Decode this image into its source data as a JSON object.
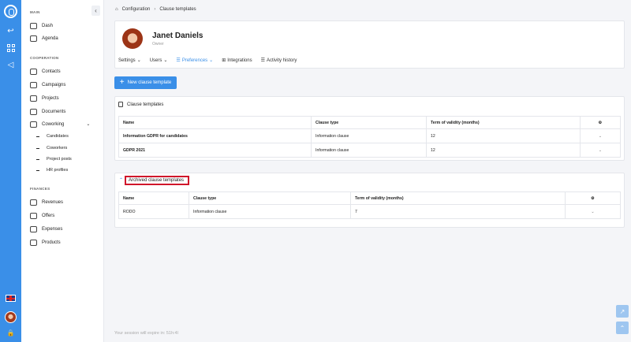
{
  "sidebar": {
    "sections": {
      "main": "MAIN",
      "cooperation": "COOPERATION",
      "finances": "FINANCES"
    },
    "main_items": [
      {
        "label": "Dash",
        "icon": "dashboard-icon"
      },
      {
        "label": "Agenda",
        "icon": "calendar-icon"
      }
    ],
    "cooperation_items": [
      {
        "label": "Contacts",
        "icon": "contacts-icon"
      },
      {
        "label": "Campaigns",
        "icon": "campaigns-icon"
      },
      {
        "label": "Projects",
        "icon": "projects-icon"
      },
      {
        "label": "Documents",
        "icon": "documents-icon"
      },
      {
        "label": "Coworking",
        "icon": "coworking-icon"
      }
    ],
    "coworking_sub": [
      "Candidates",
      "Coworkers",
      "Project posts",
      "HR profiles"
    ],
    "finance_items": [
      {
        "label": "Revenues",
        "icon": "revenues-icon"
      },
      {
        "label": "Offers",
        "icon": "offers-icon"
      },
      {
        "label": "Expenses",
        "icon": "expenses-icon"
      },
      {
        "label": "Products",
        "icon": "products-icon"
      }
    ]
  },
  "breadcrumb": {
    "root": "Configuration",
    "current": "Clause templates"
  },
  "profile": {
    "name": "Janet Daniels",
    "role": "Owner"
  },
  "tabs": [
    {
      "label": "Settings",
      "has_caret": true
    },
    {
      "label": "Users",
      "has_caret": true
    },
    {
      "label": "Preferences",
      "has_caret": true,
      "active": true
    },
    {
      "label": "Integrations",
      "has_caret": false
    },
    {
      "label": "Activity history",
      "has_caret": false
    }
  ],
  "new_button": "New clause template",
  "templates": {
    "title": "Clause templates",
    "headers": [
      "Name",
      "Clause type",
      "Term of validity (months)",
      "⚙"
    ],
    "rows": [
      [
        "Information GDPR for candidates",
        "Information clause",
        "12"
      ],
      [
        "GDPR 2021",
        "Information clause",
        "12"
      ]
    ]
  },
  "archived": {
    "title": "Archived clause templates",
    "headers": [
      "Name",
      "Clause type",
      "Term of validity (months)",
      "⚙"
    ],
    "rows": [
      [
        "RODO",
        "Information clause",
        "7"
      ]
    ]
  },
  "session": "Your session will expire in: 51h:4l",
  "colors": {
    "accent": "#3a8fe8",
    "highlight": "#d0162a"
  }
}
